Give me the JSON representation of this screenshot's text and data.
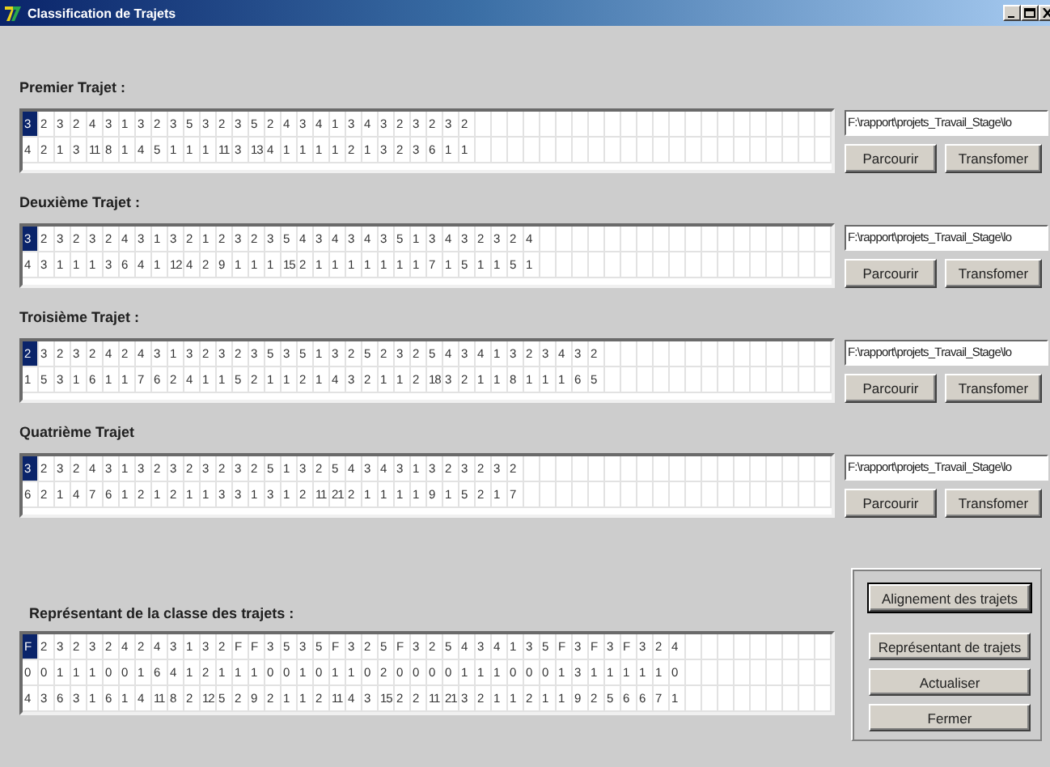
{
  "window": {
    "title": "Classification de Trajets"
  },
  "trajets": [
    {
      "label": "Premier Trajet :",
      "path": "F:\\rapport\\projets_Travail_Stage\\lo",
      "buttons": [
        "Parcourir",
        "Transfomer"
      ],
      "rows": [
        [
          {
            "text": "3",
            "selected": true
          },
          {
            "text": "2",
            "selected": false
          },
          {
            "text": "3",
            "selected": false
          },
          {
            "text": "2",
            "selected": false
          },
          {
            "text": "4",
            "selected": false
          },
          {
            "text": "3",
            "selected": false
          },
          {
            "text": "1",
            "selected": false
          },
          {
            "text": "3",
            "selected": false
          },
          {
            "text": "2",
            "selected": false
          },
          {
            "text": "3",
            "selected": false
          },
          {
            "text": "5",
            "selected": false
          },
          {
            "text": "3",
            "selected": false
          },
          {
            "text": "2",
            "selected": false
          },
          {
            "text": "3",
            "selected": false
          },
          {
            "text": "5",
            "selected": false
          },
          {
            "text": "2",
            "selected": false
          },
          {
            "text": "4",
            "selected": false
          },
          {
            "text": "3",
            "selected": false
          },
          {
            "text": "4",
            "selected": false
          },
          {
            "text": "1",
            "selected": false
          },
          {
            "text": "3",
            "selected": false
          },
          {
            "text": "4",
            "selected": false
          },
          {
            "text": "3",
            "selected": false
          },
          {
            "text": "2",
            "selected": false
          },
          {
            "text": "3",
            "selected": false
          },
          {
            "text": "2",
            "selected": false
          },
          {
            "text": "3",
            "selected": false
          },
          {
            "text": "2",
            "selected": false
          }
        ],
        [
          {
            "text": "4",
            "selected": false
          },
          {
            "text": "2",
            "selected": false
          },
          {
            "text": "1",
            "selected": false
          },
          {
            "text": "3",
            "selected": false
          },
          {
            "text": "11",
            "selected": false
          },
          {
            "text": "8",
            "selected": false
          },
          {
            "text": "1",
            "selected": false
          },
          {
            "text": "4",
            "selected": false
          },
          {
            "text": "5",
            "selected": false
          },
          {
            "text": "1",
            "selected": false
          },
          {
            "text": "1",
            "selected": false
          },
          {
            "text": "1",
            "selected": false
          },
          {
            "text": "11",
            "selected": false
          },
          {
            "text": "3",
            "selected": false
          },
          {
            "text": "13",
            "selected": false
          },
          {
            "text": "4",
            "selected": false
          },
          {
            "text": "1",
            "selected": false
          },
          {
            "text": "1",
            "selected": false
          },
          {
            "text": "1",
            "selected": false
          },
          {
            "text": "1",
            "selected": false
          },
          {
            "text": "2",
            "selected": false
          },
          {
            "text": "1",
            "selected": false
          },
          {
            "text": "3",
            "selected": false
          },
          {
            "text": "2",
            "selected": false
          },
          {
            "text": "3",
            "selected": false
          },
          {
            "text": "6",
            "selected": false
          },
          {
            "text": "1",
            "selected": false
          },
          {
            "text": "1",
            "selected": false
          }
        ]
      ]
    },
    {
      "label": "Deuxième Trajet :",
      "path": "F:\\rapport\\projets_Travail_Stage\\lo",
      "buttons": [
        "Parcourir",
        "Transfomer"
      ],
      "rows": [
        [
          {
            "text": "3",
            "selected": true
          },
          {
            "text": "2",
            "selected": false
          },
          {
            "text": "3",
            "selected": false
          },
          {
            "text": "2",
            "selected": false
          },
          {
            "text": "3",
            "selected": false
          },
          {
            "text": "2",
            "selected": false
          },
          {
            "text": "4",
            "selected": false
          },
          {
            "text": "3",
            "selected": false
          },
          {
            "text": "1",
            "selected": false
          },
          {
            "text": "3",
            "selected": false
          },
          {
            "text": "2",
            "selected": false
          },
          {
            "text": "1",
            "selected": false
          },
          {
            "text": "2",
            "selected": false
          },
          {
            "text": "3",
            "selected": false
          },
          {
            "text": "2",
            "selected": false
          },
          {
            "text": "3",
            "selected": false
          },
          {
            "text": "5",
            "selected": false
          },
          {
            "text": "4",
            "selected": false
          },
          {
            "text": "3",
            "selected": false
          },
          {
            "text": "4",
            "selected": false
          },
          {
            "text": "3",
            "selected": false
          },
          {
            "text": "4",
            "selected": false
          },
          {
            "text": "3",
            "selected": false
          },
          {
            "text": "5",
            "selected": false
          },
          {
            "text": "1",
            "selected": false
          },
          {
            "text": "3",
            "selected": false
          },
          {
            "text": "4",
            "selected": false
          },
          {
            "text": "3",
            "selected": false
          },
          {
            "text": "2",
            "selected": false
          },
          {
            "text": "3",
            "selected": false
          },
          {
            "text": "2",
            "selected": false
          },
          {
            "text": "4",
            "selected": false
          }
        ],
        [
          {
            "text": "4",
            "selected": false
          },
          {
            "text": "3",
            "selected": false
          },
          {
            "text": "1",
            "selected": false
          },
          {
            "text": "1",
            "selected": false
          },
          {
            "text": "1",
            "selected": false
          },
          {
            "text": "3",
            "selected": false
          },
          {
            "text": "6",
            "selected": false
          },
          {
            "text": "4",
            "selected": false
          },
          {
            "text": "1",
            "selected": false
          },
          {
            "text": "12",
            "selected": false
          },
          {
            "text": "4",
            "selected": false
          },
          {
            "text": "2",
            "selected": false
          },
          {
            "text": "9",
            "selected": false
          },
          {
            "text": "1",
            "selected": false
          },
          {
            "text": "1",
            "selected": false
          },
          {
            "text": "1",
            "selected": false
          },
          {
            "text": "15",
            "selected": false
          },
          {
            "text": "2",
            "selected": false
          },
          {
            "text": "1",
            "selected": false
          },
          {
            "text": "1",
            "selected": false
          },
          {
            "text": "1",
            "selected": false
          },
          {
            "text": "1",
            "selected": false
          },
          {
            "text": "1",
            "selected": false
          },
          {
            "text": "1",
            "selected": false
          },
          {
            "text": "1",
            "selected": false
          },
          {
            "text": "7",
            "selected": false
          },
          {
            "text": "1",
            "selected": false
          },
          {
            "text": "5",
            "selected": false
          },
          {
            "text": "1",
            "selected": false
          },
          {
            "text": "1",
            "selected": false
          },
          {
            "text": "5",
            "selected": false
          },
          {
            "text": "1",
            "selected": false
          }
        ]
      ]
    },
    {
      "label": "Troisième Trajet :",
      "path": "F:\\rapport\\projets_Travail_Stage\\lo",
      "buttons": [
        "Parcourir",
        "Transfomer"
      ],
      "rows": [
        [
          {
            "text": "2",
            "selected": true
          },
          {
            "text": "3",
            "selected": false
          },
          {
            "text": "2",
            "selected": false
          },
          {
            "text": "3",
            "selected": false
          },
          {
            "text": "2",
            "selected": false
          },
          {
            "text": "4",
            "selected": false
          },
          {
            "text": "2",
            "selected": false
          },
          {
            "text": "4",
            "selected": false
          },
          {
            "text": "3",
            "selected": false
          },
          {
            "text": "1",
            "selected": false
          },
          {
            "text": "3",
            "selected": false
          },
          {
            "text": "2",
            "selected": false
          },
          {
            "text": "3",
            "selected": false
          },
          {
            "text": "2",
            "selected": false
          },
          {
            "text": "3",
            "selected": false
          },
          {
            "text": "5",
            "selected": false
          },
          {
            "text": "3",
            "selected": false
          },
          {
            "text": "5",
            "selected": false
          },
          {
            "text": "1",
            "selected": false
          },
          {
            "text": "3",
            "selected": false
          },
          {
            "text": "2",
            "selected": false
          },
          {
            "text": "5",
            "selected": false
          },
          {
            "text": "2",
            "selected": false
          },
          {
            "text": "3",
            "selected": false
          },
          {
            "text": "2",
            "selected": false
          },
          {
            "text": "5",
            "selected": false
          },
          {
            "text": "4",
            "selected": false
          },
          {
            "text": "3",
            "selected": false
          },
          {
            "text": "4",
            "selected": false
          },
          {
            "text": "1",
            "selected": false
          },
          {
            "text": "3",
            "selected": false
          },
          {
            "text": "2",
            "selected": false
          },
          {
            "text": "3",
            "selected": false
          },
          {
            "text": "4",
            "selected": false
          },
          {
            "text": "3",
            "selected": false
          },
          {
            "text": "2",
            "selected": false
          }
        ],
        [
          {
            "text": "1",
            "selected": false
          },
          {
            "text": "5",
            "selected": false
          },
          {
            "text": "3",
            "selected": false
          },
          {
            "text": "1",
            "selected": false
          },
          {
            "text": "6",
            "selected": false
          },
          {
            "text": "1",
            "selected": false
          },
          {
            "text": "1",
            "selected": false
          },
          {
            "text": "7",
            "selected": false
          },
          {
            "text": "6",
            "selected": false
          },
          {
            "text": "2",
            "selected": false
          },
          {
            "text": "4",
            "selected": false
          },
          {
            "text": "1",
            "selected": false
          },
          {
            "text": "1",
            "selected": false
          },
          {
            "text": "5",
            "selected": false
          },
          {
            "text": "2",
            "selected": false
          },
          {
            "text": "1",
            "selected": false
          },
          {
            "text": "1",
            "selected": false
          },
          {
            "text": "2",
            "selected": false
          },
          {
            "text": "1",
            "selected": false
          },
          {
            "text": "4",
            "selected": false
          },
          {
            "text": "3",
            "selected": false
          },
          {
            "text": "2",
            "selected": false
          },
          {
            "text": "1",
            "selected": false
          },
          {
            "text": "1",
            "selected": false
          },
          {
            "text": "2",
            "selected": false
          },
          {
            "text": "18",
            "selected": false
          },
          {
            "text": "3",
            "selected": false
          },
          {
            "text": "2",
            "selected": false
          },
          {
            "text": "1",
            "selected": false
          },
          {
            "text": "1",
            "selected": false
          },
          {
            "text": "8",
            "selected": false
          },
          {
            "text": "1",
            "selected": false
          },
          {
            "text": "1",
            "selected": false
          },
          {
            "text": "1",
            "selected": false
          },
          {
            "text": "6",
            "selected": false
          },
          {
            "text": "5",
            "selected": false
          }
        ]
      ]
    },
    {
      "label": "Quatrième Trajet",
      "path": "F:\\rapport\\projets_Travail_Stage\\lo",
      "buttons": [
        "Parcourir",
        "Transfomer"
      ],
      "rows": [
        [
          {
            "text": "3",
            "selected": true
          },
          {
            "text": "2",
            "selected": false
          },
          {
            "text": "3",
            "selected": false
          },
          {
            "text": "2",
            "selected": false
          },
          {
            "text": "4",
            "selected": false
          },
          {
            "text": "3",
            "selected": false
          },
          {
            "text": "1",
            "selected": false
          },
          {
            "text": "3",
            "selected": false
          },
          {
            "text": "2",
            "selected": false
          },
          {
            "text": "3",
            "selected": false
          },
          {
            "text": "2",
            "selected": false
          },
          {
            "text": "3",
            "selected": false
          },
          {
            "text": "2",
            "selected": false
          },
          {
            "text": "3",
            "selected": false
          },
          {
            "text": "2",
            "selected": false
          },
          {
            "text": "5",
            "selected": false
          },
          {
            "text": "1",
            "selected": false
          },
          {
            "text": "3",
            "selected": false
          },
          {
            "text": "2",
            "selected": false
          },
          {
            "text": "5",
            "selected": false
          },
          {
            "text": "4",
            "selected": false
          },
          {
            "text": "3",
            "selected": false
          },
          {
            "text": "4",
            "selected": false
          },
          {
            "text": "3",
            "selected": false
          },
          {
            "text": "1",
            "selected": false
          },
          {
            "text": "3",
            "selected": false
          },
          {
            "text": "2",
            "selected": false
          },
          {
            "text": "3",
            "selected": false
          },
          {
            "text": "2",
            "selected": false
          },
          {
            "text": "3",
            "selected": false
          },
          {
            "text": "2",
            "selected": false
          }
        ],
        [
          {
            "text": "6",
            "selected": false
          },
          {
            "text": "2",
            "selected": false
          },
          {
            "text": "1",
            "selected": false
          },
          {
            "text": "4",
            "selected": false
          },
          {
            "text": "7",
            "selected": false
          },
          {
            "text": "6",
            "selected": false
          },
          {
            "text": "1",
            "selected": false
          },
          {
            "text": "2",
            "selected": false
          },
          {
            "text": "1",
            "selected": false
          },
          {
            "text": "2",
            "selected": false
          },
          {
            "text": "1",
            "selected": false
          },
          {
            "text": "1",
            "selected": false
          },
          {
            "text": "3",
            "selected": false
          },
          {
            "text": "3",
            "selected": false
          },
          {
            "text": "1",
            "selected": false
          },
          {
            "text": "3",
            "selected": false
          },
          {
            "text": "1",
            "selected": false
          },
          {
            "text": "2",
            "selected": false
          },
          {
            "text": "11",
            "selected": false
          },
          {
            "text": "21",
            "selected": false
          },
          {
            "text": "2",
            "selected": false
          },
          {
            "text": "1",
            "selected": false
          },
          {
            "text": "1",
            "selected": false
          },
          {
            "text": "1",
            "selected": false
          },
          {
            "text": "1",
            "selected": false
          },
          {
            "text": "9",
            "selected": false
          },
          {
            "text": "1",
            "selected": false
          },
          {
            "text": "5",
            "selected": false
          },
          {
            "text": "2",
            "selected": false
          },
          {
            "text": "1",
            "selected": false
          },
          {
            "text": "7",
            "selected": false
          }
        ]
      ]
    }
  ],
  "representant": {
    "label": "Représentant de la classe des trajets  :",
    "rows": [
      [
        {
          "text": "F",
          "selected": true
        },
        {
          "text": "2",
          "selected": false
        },
        {
          "text": "3",
          "selected": false
        },
        {
          "text": "2",
          "selected": false
        },
        {
          "text": "3",
          "selected": false
        },
        {
          "text": "2",
          "selected": false
        },
        {
          "text": "4",
          "selected": false
        },
        {
          "text": "2",
          "selected": false
        },
        {
          "text": "4",
          "selected": false
        },
        {
          "text": "3",
          "selected": false
        },
        {
          "text": "1",
          "selected": false
        },
        {
          "text": "3",
          "selected": false
        },
        {
          "text": "2",
          "selected": false
        },
        {
          "text": "F",
          "selected": false
        },
        {
          "text": "F",
          "selected": false
        },
        {
          "text": "3",
          "selected": false
        },
        {
          "text": "5",
          "selected": false
        },
        {
          "text": "3",
          "selected": false
        },
        {
          "text": "5",
          "selected": false
        },
        {
          "text": "F",
          "selected": false
        },
        {
          "text": "3",
          "selected": false
        },
        {
          "text": "2",
          "selected": false
        },
        {
          "text": "5",
          "selected": false
        },
        {
          "text": "F",
          "selected": false
        },
        {
          "text": "3",
          "selected": false
        },
        {
          "text": "2",
          "selected": false
        },
        {
          "text": "5",
          "selected": false
        },
        {
          "text": "4",
          "selected": false
        },
        {
          "text": "3",
          "selected": false
        },
        {
          "text": "4",
          "selected": false
        },
        {
          "text": "1",
          "selected": false
        },
        {
          "text": "3",
          "selected": false
        },
        {
          "text": "5",
          "selected": false
        },
        {
          "text": "F",
          "selected": false
        },
        {
          "text": "3",
          "selected": false
        },
        {
          "text": "F",
          "selected": false
        },
        {
          "text": "3",
          "selected": false
        },
        {
          "text": "F",
          "selected": false
        },
        {
          "text": "3",
          "selected": false
        },
        {
          "text": "2",
          "selected": false
        },
        {
          "text": "4",
          "selected": false
        }
      ],
      [
        {
          "text": "0",
          "selected": false
        },
        {
          "text": "0",
          "selected": false
        },
        {
          "text": "1",
          "selected": false
        },
        {
          "text": "1",
          "selected": false
        },
        {
          "text": "1",
          "selected": false
        },
        {
          "text": "0",
          "selected": false
        },
        {
          "text": "0",
          "selected": false
        },
        {
          "text": "1",
          "selected": false
        },
        {
          "text": "6",
          "selected": false
        },
        {
          "text": "4",
          "selected": false
        },
        {
          "text": "1",
          "selected": false
        },
        {
          "text": "2",
          "selected": false
        },
        {
          "text": "1",
          "selected": false
        },
        {
          "text": "1",
          "selected": false
        },
        {
          "text": "1",
          "selected": false
        },
        {
          "text": "0",
          "selected": false
        },
        {
          "text": "0",
          "selected": false
        },
        {
          "text": "1",
          "selected": false
        },
        {
          "text": "0",
          "selected": false
        },
        {
          "text": "1",
          "selected": false
        },
        {
          "text": "1",
          "selected": false
        },
        {
          "text": "0",
          "selected": false
        },
        {
          "text": "2",
          "selected": false
        },
        {
          "text": "0",
          "selected": false
        },
        {
          "text": "0",
          "selected": false
        },
        {
          "text": "0",
          "selected": false
        },
        {
          "text": "0",
          "selected": false
        },
        {
          "text": "1",
          "selected": false
        },
        {
          "text": "1",
          "selected": false
        },
        {
          "text": "1",
          "selected": false
        },
        {
          "text": "0",
          "selected": false
        },
        {
          "text": "0",
          "selected": false
        },
        {
          "text": "0",
          "selected": false
        },
        {
          "text": "1",
          "selected": false
        },
        {
          "text": "3",
          "selected": false
        },
        {
          "text": "1",
          "selected": false
        },
        {
          "text": "1",
          "selected": false
        },
        {
          "text": "1",
          "selected": false
        },
        {
          "text": "1",
          "selected": false
        },
        {
          "text": "1",
          "selected": false
        },
        {
          "text": "0",
          "selected": false
        }
      ],
      [
        {
          "text": "4",
          "selected": false
        },
        {
          "text": "3",
          "selected": false
        },
        {
          "text": "6",
          "selected": false
        },
        {
          "text": "3",
          "selected": false
        },
        {
          "text": "1",
          "selected": false
        },
        {
          "text": "6",
          "selected": false
        },
        {
          "text": "1",
          "selected": false
        },
        {
          "text": "4",
          "selected": false
        },
        {
          "text": "11",
          "selected": false
        },
        {
          "text": "8",
          "selected": false
        },
        {
          "text": "2",
          "selected": false
        },
        {
          "text": "12",
          "selected": false
        },
        {
          "text": "5",
          "selected": false
        },
        {
          "text": "2",
          "selected": false
        },
        {
          "text": "9",
          "selected": false
        },
        {
          "text": "2",
          "selected": false
        },
        {
          "text": "1",
          "selected": false
        },
        {
          "text": "1",
          "selected": false
        },
        {
          "text": "2",
          "selected": false
        },
        {
          "text": "11",
          "selected": false
        },
        {
          "text": "4",
          "selected": false
        },
        {
          "text": "3",
          "selected": false
        },
        {
          "text": "15",
          "selected": false
        },
        {
          "text": "2",
          "selected": false
        },
        {
          "text": "2",
          "selected": false
        },
        {
          "text": "11",
          "selected": false
        },
        {
          "text": "21",
          "selected": false
        },
        {
          "text": "3",
          "selected": false
        },
        {
          "text": "2",
          "selected": false
        },
        {
          "text": "1",
          "selected": false
        },
        {
          "text": "1",
          "selected": false
        },
        {
          "text": "2",
          "selected": false
        },
        {
          "text": "1",
          "selected": false
        },
        {
          "text": "1",
          "selected": false
        },
        {
          "text": "9",
          "selected": false
        },
        {
          "text": "2",
          "selected": false
        },
        {
          "text": "5",
          "selected": false
        },
        {
          "text": "6",
          "selected": false
        },
        {
          "text": "6",
          "selected": false
        },
        {
          "text": "7",
          "selected": false
        },
        {
          "text": "1",
          "selected": false
        }
      ]
    ]
  },
  "actions": [
    {
      "label": "Alignement des trajets",
      "default": true
    },
    {
      "label": "Représentant de trajets",
      "default": false
    },
    {
      "label": "Actualiser",
      "default": false
    },
    {
      "label": "Fermer",
      "default": false
    }
  ]
}
